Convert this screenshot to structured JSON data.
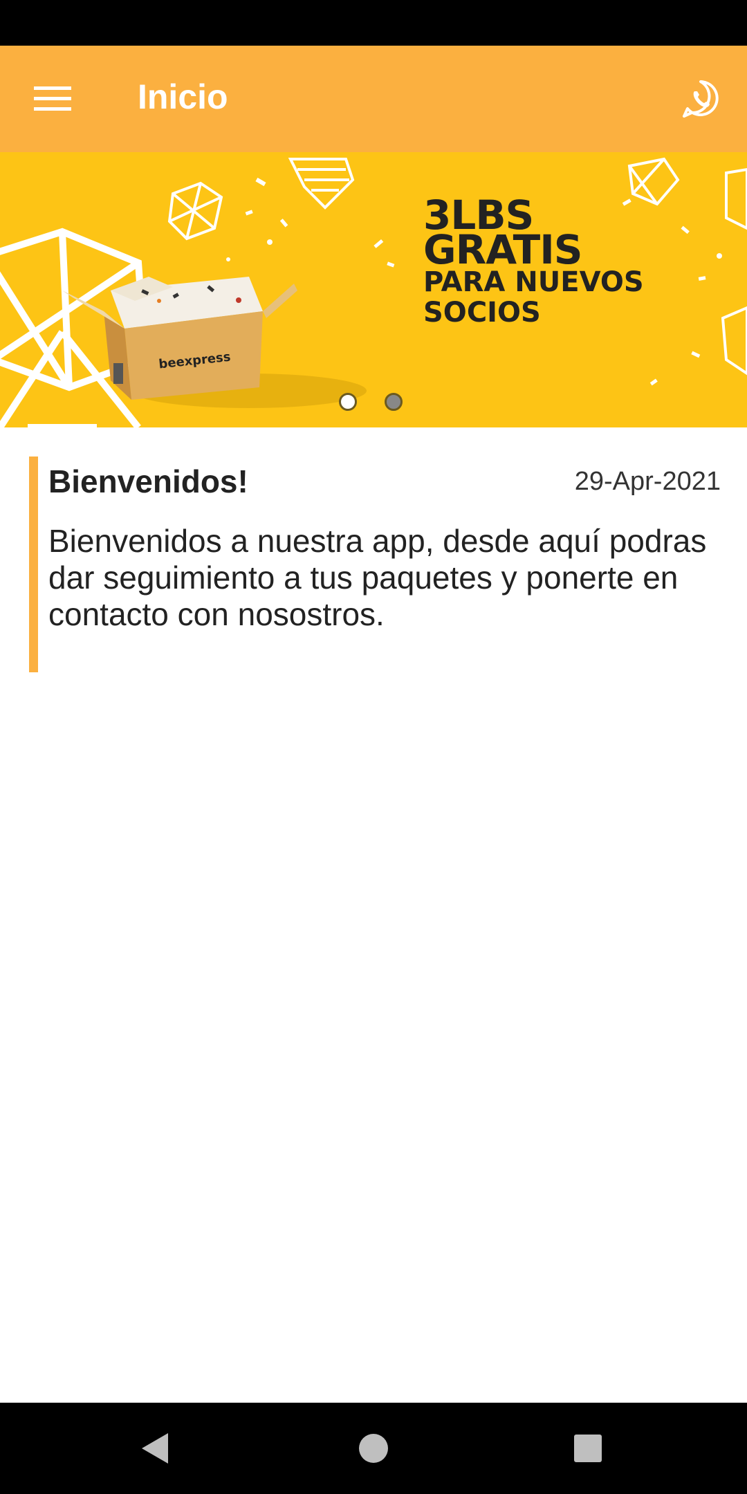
{
  "app_bar": {
    "title": "Inicio",
    "background": "#fbb040",
    "menu_icon": "menu-icon",
    "action_icon": "whatsapp-icon"
  },
  "banner": {
    "line1": "3LBS",
    "line2": "GRATIS",
    "line3": "PARA NUEVOS",
    "line4": "SOCIOS",
    "box_brand": "beexpress",
    "background": "#fdc415",
    "slides": 2,
    "active_slide": 1
  },
  "card": {
    "title": "Bienvenidos!",
    "date": "29-Apr-2021",
    "body": "Bienvenidos a nuestra app, desde aquí podras dar seguimiento a tus paquetes y ponerte en contacto con nosostros.",
    "accent": "#fbb040"
  },
  "nav": {
    "back_icon": "back-triangle-icon",
    "home_icon": "home-circle-icon",
    "recents_icon": "recents-square-icon"
  }
}
